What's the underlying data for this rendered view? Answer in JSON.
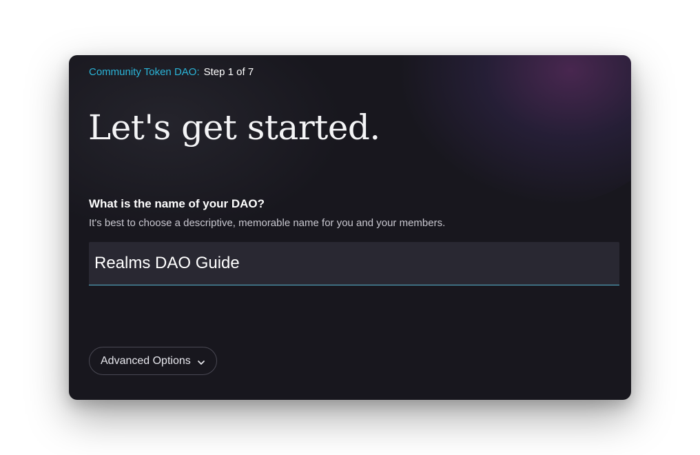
{
  "breadcrumb": {
    "dao_type": "Community Token DAO:",
    "step": "Step 1 of 7"
  },
  "page": {
    "title": "Let's get started."
  },
  "form": {
    "question": "What is the name of your DAO?",
    "hint": "It's best to choose a descriptive, memorable name for you and your members.",
    "name_value": "Realms DAO Guide"
  },
  "advanced": {
    "label": "Advanced Options",
    "icon": "chevron-down-icon"
  },
  "colors": {
    "accent": "#2bb4d8",
    "card_bg": "#18171e",
    "input_bg": "#292832"
  }
}
